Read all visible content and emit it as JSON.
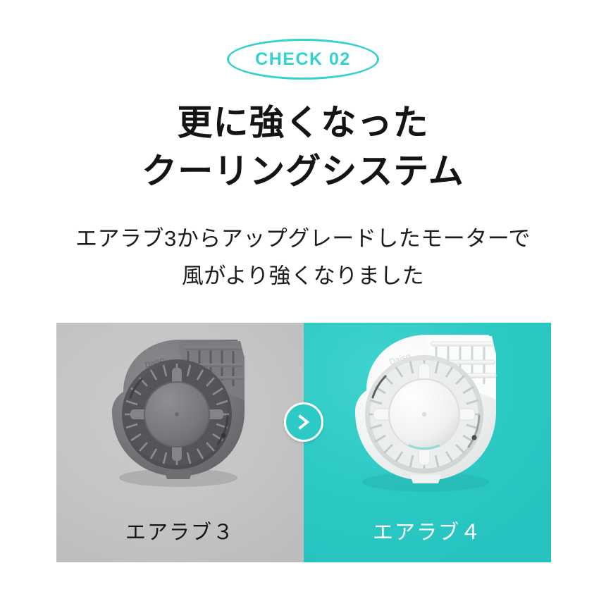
{
  "badge": {
    "label": "CHECK 02",
    "accent_color": "#35d2cd",
    "shape": "ellipse-outline"
  },
  "headline": {
    "lines": [
      "更に強くなった",
      "クーリングシステム"
    ],
    "color": "#141414"
  },
  "subheadline": {
    "lines": [
      "エアラブ3からアップグレードしたモーターで",
      "風がより強くなりました"
    ],
    "color": "#1c1c1c"
  },
  "comparison": {
    "arrow_icon": "chevron-right-icon",
    "arrow_color": "#2dcac5",
    "panels": [
      {
        "id": "old",
        "label": "エアラブ３",
        "background_color": "#c5c5c5",
        "label_color": "#161616",
        "product_image": "blower-fan-dark-gray",
        "product_body_color": "#6f7173",
        "product_brand_mark": "Daiso"
      },
      {
        "id": "new",
        "label": "エアラブ４",
        "background_color": "#2cc9c4",
        "label_color": "#ffffff",
        "product_image": "blower-fan-white",
        "product_body_color": "#f3f4f4",
        "product_brand_mark": "Daiso"
      }
    ]
  }
}
